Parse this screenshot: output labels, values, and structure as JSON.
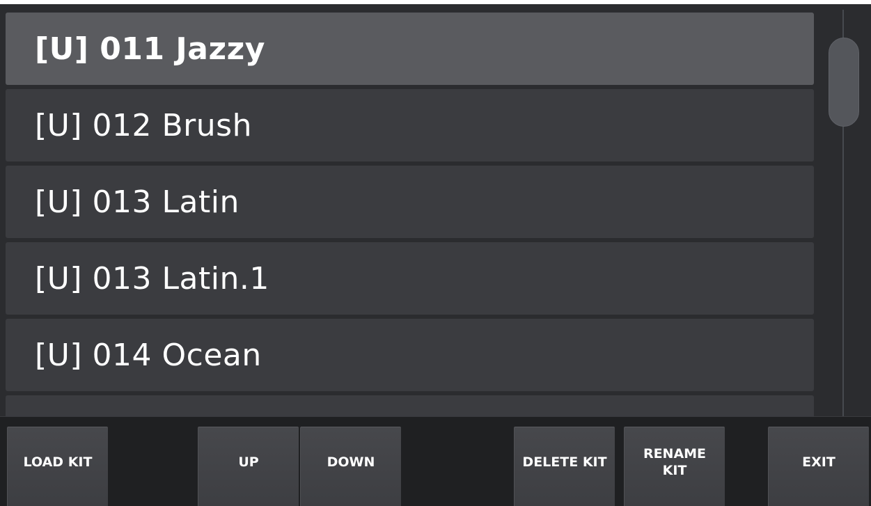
{
  "kit_list": {
    "items": [
      {
        "label": "[U] 011 Jazzy",
        "selected": true
      },
      {
        "label": "[U] 012 Brush",
        "selected": false
      },
      {
        "label": "[U] 013 Latin",
        "selected": false
      },
      {
        "label": "[U] 013 Latin.1",
        "selected": false
      },
      {
        "label": "[U] 014 Ocean",
        "selected": false
      },
      {
        "label": "",
        "selected": false
      }
    ]
  },
  "toolbar": {
    "load_kit": "LOAD KIT",
    "up": "UP",
    "down": "DOWN",
    "delete_kit": "DELETE KIT",
    "rename_kit_line1": "RENAME",
    "rename_kit_line2": "KIT",
    "exit": "EXIT"
  },
  "colors": {
    "background": "#2b2c2f",
    "row": "#3b3c40",
    "row_selected": "#5a5b5f",
    "button": "#434448",
    "text": "#ffffff"
  }
}
